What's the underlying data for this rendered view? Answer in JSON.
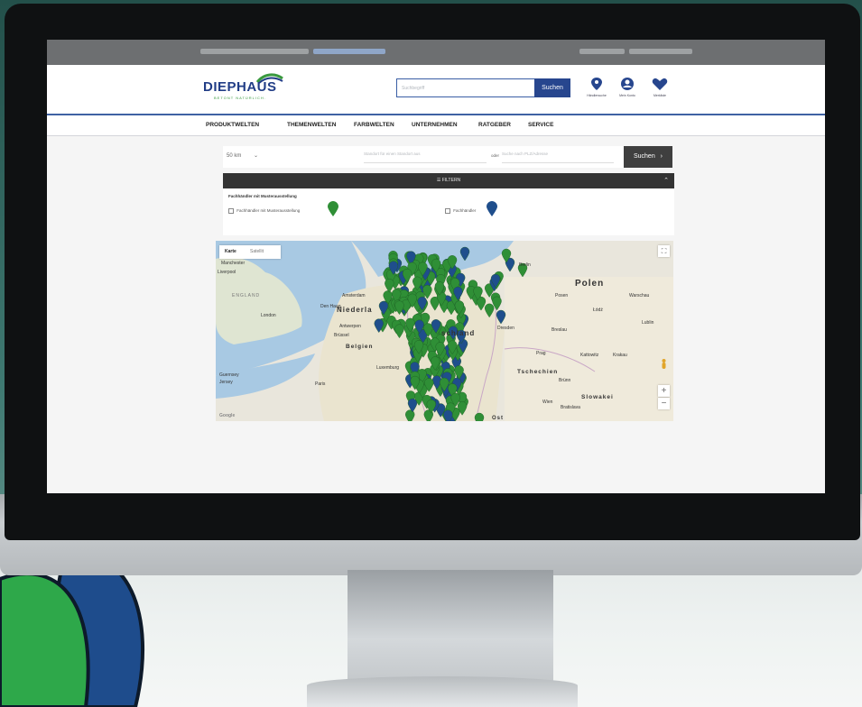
{
  "site": {
    "logo_text": "DIEPHAUS",
    "logo_tagline": "BETONT NATÜRLICH.",
    "brand_blue": "#213d86",
    "brand_green": "#3a9a3f"
  },
  "header": {
    "search_placeholder": "Suchbegriff",
    "search_button": "Suchen",
    "icons": [
      {
        "icon": "location-pin-icon",
        "label": "Händlersuche"
      },
      {
        "icon": "account-icon",
        "label": "Mein Konto"
      },
      {
        "icon": "heart-icon",
        "label": "Merkliste"
      }
    ]
  },
  "nav": {
    "items": [
      "PRODUKTWELTEN",
      "THEMENWELTEN",
      "FARBWELTEN",
      "UNTERNEHMEN",
      "RATGEBER",
      "SERVICE"
    ]
  },
  "dealer_search": {
    "radius": "50 km",
    "location_placeholder": "Standort für einen Standort aus",
    "or_text": "oder",
    "zip_placeholder": "Suche nach PLZ/Adresse",
    "button": "Suchen",
    "filter_label": "FILTERN",
    "filter_title": "Fachhändler mit Musterausstellung",
    "options": [
      {
        "label": "Fachhändler mit Musterausstellung",
        "marker_color": "#2f8f36"
      },
      {
        "label": "Fachhändler",
        "marker_color": "#1f4e8c"
      }
    ]
  },
  "map": {
    "tabs": [
      "Karte",
      "Satellit"
    ],
    "labels": {
      "manchester": "Manchester",
      "liverpool": "Liverpool",
      "england": "ENGLAND",
      "london": "London",
      "netherlands": "Niederla",
      "amsterdam": "Amsterdam",
      "den_haag": "Den Haag",
      "antwerp": "Antwerpen",
      "brussels": "Brüssel",
      "belgium": "Belgien",
      "luxembourg": "Luxemburg",
      "paris": "Paris",
      "guernsey": "Guernsey",
      "jersey": "Jersey",
      "germany": "schland",
      "poland": "Polen",
      "czech": "Tschechien",
      "slovakia": "Slowakei",
      "prague": "Prag",
      "berlin": "Berlin",
      "dresden": "Dresden",
      "warsaw": "Warschau",
      "lodz": "Łódź",
      "lublin": "Lublin",
      "wroclaw": "Breslau",
      "poznan": "Posen",
      "katowice": "Kattowitz",
      "krakow": "Krakau",
      "brno": "Brünn",
      "vienna": "Wien",
      "bratislava": "Bratislava",
      "google": "Google",
      "ost": "Ost"
    },
    "zoom_in": "+",
    "zoom_out": "−",
    "fullscreen": "⛶"
  }
}
